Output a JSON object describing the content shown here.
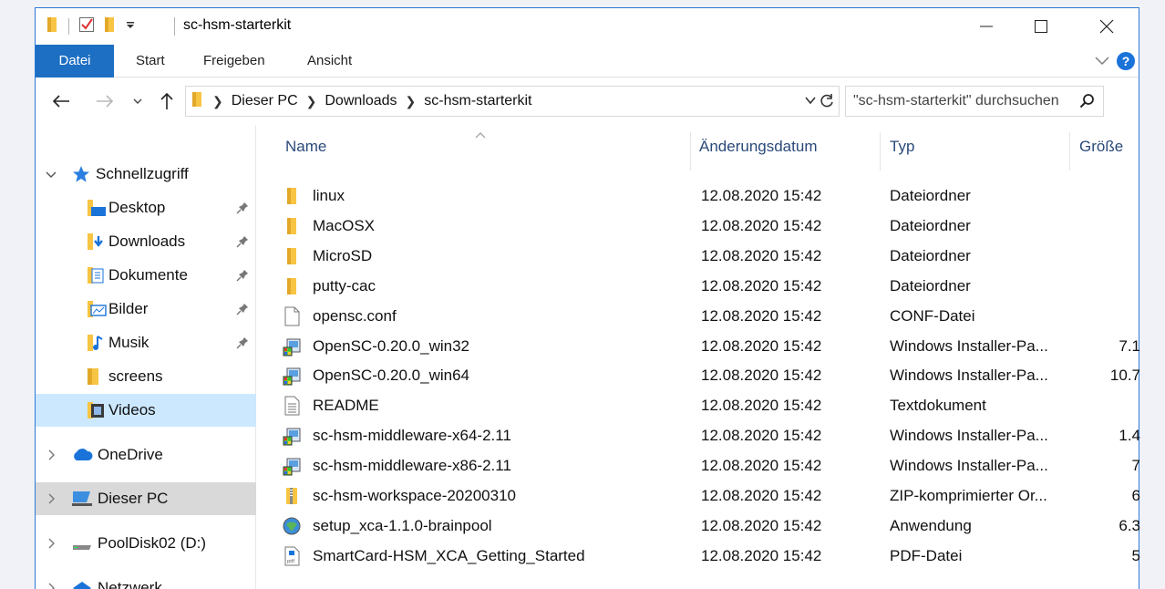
{
  "window": {
    "title": "sc-hsm-starterkit"
  },
  "ribbon": {
    "tabs": [
      "Datei",
      "Start",
      "Freigeben",
      "Ansicht"
    ],
    "help": "?"
  },
  "address": {
    "crumbs": [
      "Dieser PC",
      "Downloads",
      "sc-hsm-starterkit"
    ],
    "search_placeholder": "\"sc-hsm-starterkit\" durchsuchen"
  },
  "nav": {
    "quick_access": "Schnellzugriff",
    "quick_items": [
      {
        "label": "Desktop",
        "icon": "desktop-folder-icon",
        "pinned": true
      },
      {
        "label": "Downloads",
        "icon": "downloads-folder-icon",
        "pinned": true
      },
      {
        "label": "Dokumente",
        "icon": "documents-folder-icon",
        "pinned": true
      },
      {
        "label": "Bilder",
        "icon": "pictures-folder-icon",
        "pinned": true
      },
      {
        "label": "Musik",
        "icon": "music-folder-icon",
        "pinned": true
      },
      {
        "label": "screens",
        "icon": "folder-icon",
        "pinned": false
      },
      {
        "label": "Videos",
        "icon": "videos-folder-icon",
        "pinned": false,
        "selected": true
      }
    ],
    "onedrive": "OneDrive",
    "this_pc": "Dieser PC",
    "pooldisk": "PoolDisk02 (D:)",
    "network": "Netzwerk"
  },
  "columns": {
    "name": "Name",
    "date": "Änderungsdatum",
    "type": "Typ",
    "size": "Größe"
  },
  "files": [
    {
      "name": "linux",
      "date": "12.08.2020 15:42",
      "type": "Dateiordner",
      "size": "",
      "icon": "folder-icon"
    },
    {
      "name": "MacOSX",
      "date": "12.08.2020 15:42",
      "type": "Dateiordner",
      "size": "",
      "icon": "folder-icon"
    },
    {
      "name": "MicroSD",
      "date": "12.08.2020 15:42",
      "type": "Dateiordner",
      "size": "",
      "icon": "folder-icon"
    },
    {
      "name": "putty-cac",
      "date": "12.08.2020 15:42",
      "type": "Dateiordner",
      "size": "",
      "icon": "folder-icon"
    },
    {
      "name": "opensc.conf",
      "date": "12.08.2020 15:42",
      "type": "CONF-Datei",
      "size": "",
      "icon": "file-icon"
    },
    {
      "name": "OpenSC-0.20.0_win32",
      "date": "12.08.2020 15:42",
      "type": "Windows Installer-Pa...",
      "size": "7.1",
      "icon": "installer-icon"
    },
    {
      "name": "OpenSC-0.20.0_win64",
      "date": "12.08.2020 15:42",
      "type": "Windows Installer-Pa...",
      "size": "10.7",
      "icon": "installer-icon"
    },
    {
      "name": "README",
      "date": "12.08.2020 15:42",
      "type": "Textdokument",
      "size": "",
      "icon": "text-file-icon"
    },
    {
      "name": "sc-hsm-middleware-x64-2.11",
      "date": "12.08.2020 15:42",
      "type": "Windows Installer-Pa...",
      "size": "1.4",
      "icon": "installer-icon"
    },
    {
      "name": "sc-hsm-middleware-x86-2.11",
      "date": "12.08.2020 15:42",
      "type": "Windows Installer-Pa...",
      "size": "7",
      "icon": "installer-icon"
    },
    {
      "name": "sc-hsm-workspace-20200310",
      "date": "12.08.2020 15:42",
      "type": "ZIP-komprimierter Or...",
      "size": "6",
      "icon": "zip-folder-icon"
    },
    {
      "name": "setup_xca-1.1.0-brainpool",
      "date": "12.08.2020 15:42",
      "type": "Anwendung",
      "size": "6.3",
      "icon": "application-icon"
    },
    {
      "name": "SmartCard-HSM_XCA_Getting_Started",
      "date": "12.08.2020 15:42",
      "type": "PDF-Datei",
      "size": "5",
      "icon": "pdf-file-icon"
    }
  ],
  "colors": {
    "accent": "#1d6fc3",
    "folder": "#f8c443",
    "selection": "#cce8ff",
    "header_text": "#2a4a7a"
  }
}
